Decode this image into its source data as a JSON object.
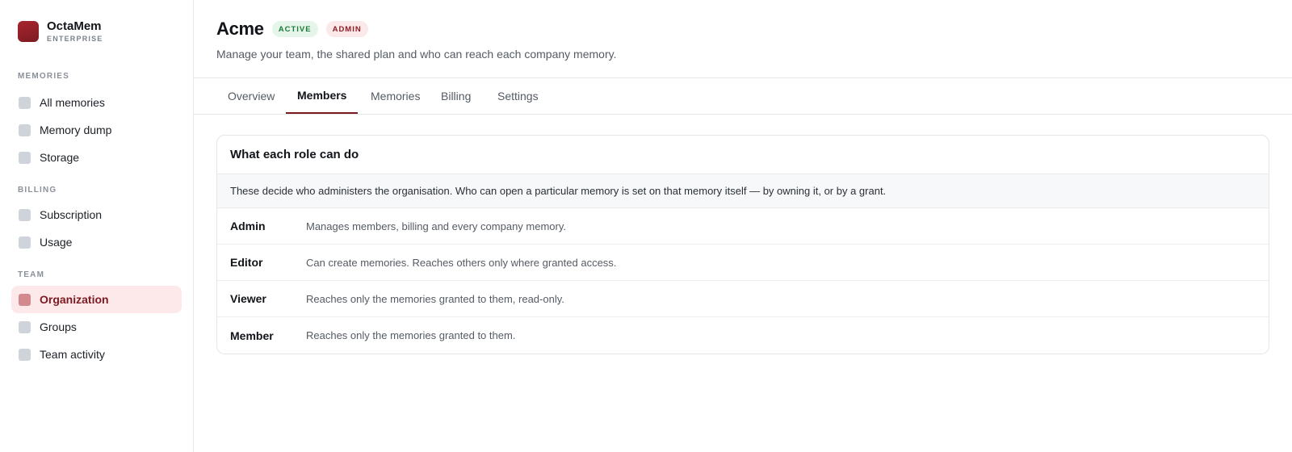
{
  "brand": {
    "name": "OctaMem",
    "sub": "ENTERPRISE"
  },
  "sidebar": {
    "sections": [
      {
        "label": "MEMORIES",
        "items": [
          {
            "label": "All memories",
            "active": false
          },
          {
            "label": "Memory dump",
            "active": false
          },
          {
            "label": "Storage",
            "active": false
          }
        ]
      },
      {
        "label": "BILLING",
        "items": [
          {
            "label": "Subscription",
            "active": false
          },
          {
            "label": "Usage",
            "active": false
          }
        ]
      },
      {
        "label": "TEAM",
        "items": [
          {
            "label": "Organization",
            "active": true
          },
          {
            "label": "Groups",
            "active": false
          },
          {
            "label": "Team activity",
            "active": false
          }
        ]
      }
    ]
  },
  "header": {
    "title": "Acme",
    "badges": [
      "ACTIVE",
      "ADMIN"
    ],
    "subtitle": "Manage your team, the shared plan and who can reach each company memory."
  },
  "tabs": [
    {
      "label": "Overview",
      "active": false
    },
    {
      "label": "Members",
      "active": true
    },
    {
      "label": "Memories",
      "active": false
    },
    {
      "label": "Billing",
      "active": false
    },
    {
      "label": "Settings",
      "active": false
    }
  ],
  "roles_card": {
    "title": "What each role can do",
    "note": "These decide who administers the organisation. Who can open a particular memory is set on that memory itself — by owning it, or by a grant.",
    "rows": [
      {
        "role": "Admin",
        "desc": "Manages members, billing and every company memory."
      },
      {
        "role": "Editor",
        "desc": "Can create memories. Reaches others only where granted access."
      },
      {
        "role": "Viewer",
        "desc": "Reaches only the memories granted to them, read-only."
      },
      {
        "role": "Member",
        "desc": "Reaches only the memories granted to them."
      }
    ]
  },
  "colors": {
    "accent": "#7c1a22",
    "active_nav_bg": "#fde9ea",
    "active_badge_bg": "#e6f5ea",
    "admin_badge_bg": "#fbe8e9"
  }
}
